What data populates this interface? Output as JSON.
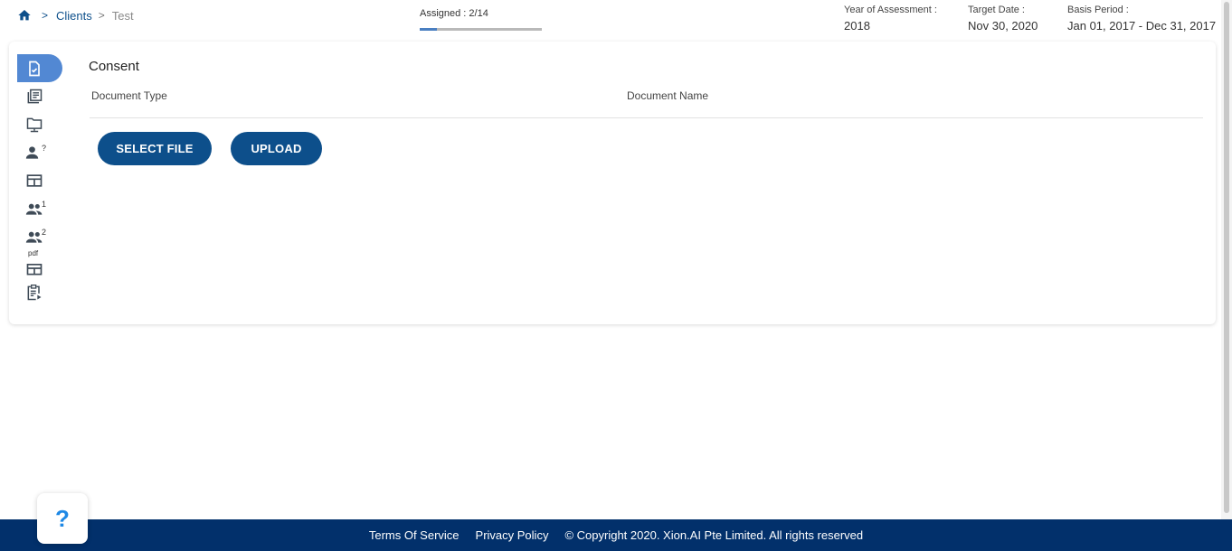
{
  "breadcrumb": {
    "home_icon": "home-icon",
    "items": [
      "Clients",
      "Test"
    ]
  },
  "assignment": {
    "label": "Assigned : 2/14",
    "progress_fraction": 0.1428
  },
  "meta": {
    "year_label": "Year of Assessment :",
    "year_value": "2018",
    "target_label": "Target Date :",
    "target_value": "Nov 30, 2020",
    "basis_label": "Basis Period :",
    "basis_value": "Jan 01, 2017 - Dec 31, 2017"
  },
  "sidenav": {
    "icons": [
      "document-check-icon",
      "library-books-icon",
      "computer-folder-icon",
      "person-question-icon",
      "table-layout-icon",
      "group-1-icon",
      "group-2-icon",
      "pdf-layout-icon",
      "clipboard-play-icon"
    ],
    "sup_1": "?",
    "sup_2": "1",
    "sup_3": "2",
    "pdf_label": "pdf"
  },
  "section": {
    "title": "Consent",
    "col_type": "Document Type",
    "col_name": "Document Name"
  },
  "actions": {
    "select_file": "SELECT FILE",
    "upload": "UPLOAD"
  },
  "help": {
    "label": "?"
  },
  "footer": {
    "terms": "Terms Of Service",
    "privacy": "Privacy Policy",
    "copyright": "© Copyright 2020. Xion.AI Pte Limited. All rights reserved"
  },
  "colors": {
    "primary": "#0d4f8b",
    "active_nav": "#5288d3",
    "footer_bg": "#02306b",
    "help": "#1e88e5"
  }
}
